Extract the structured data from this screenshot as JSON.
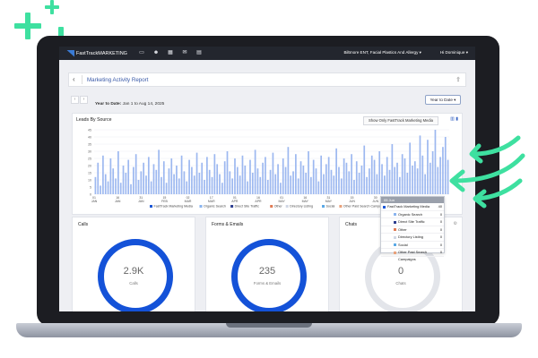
{
  "decor": {
    "accent": "#3ee0a0"
  },
  "nav": {
    "logo_text": "FastTrackMARKETING",
    "icons": [
      "monitor-icon",
      "users-icon",
      "calendar-icon",
      "mail-icon",
      "grid-icon"
    ],
    "organization": "Biltmore ENT, Facial Plastics And Allergy ▾",
    "user": "Hi Dominique ▾"
  },
  "header": {
    "title": "Marketing Activity Report",
    "back_icon": "chevron-left-icon",
    "share_icon": "share-icon"
  },
  "date_bar": {
    "prefix": "Year to Date:",
    "range": "Jan 1 to Aug 14, 2025",
    "range_button": "Year to Date ▾"
  },
  "leads_card": {
    "title": "Leads By Source",
    "filter_button": "Show Only FastTrack Marketing Media"
  },
  "chart_data": {
    "type": "bar",
    "title": "Leads By Source",
    "ylim": [
      0,
      45
    ],
    "y_ticks": [
      "0",
      "5",
      "10",
      "15",
      "20",
      "25",
      "30",
      "35",
      "40",
      "45"
    ],
    "x_ticks": [
      "01 JAN",
      "16 JAN",
      "31 JAN",
      "15 FEB",
      "02 MAR",
      "17 MAR",
      "01 APR",
      "16 APR",
      "01 MAY",
      "16 MAY",
      "31 MAY",
      "15 JUN",
      "30 JUN",
      "15 JUL",
      "30 JUL"
    ],
    "series": [
      {
        "name": "FastTrack Marketing Media",
        "color": "#1c57d6",
        "values": [
          12,
          22,
          6,
          27,
          14,
          9,
          25,
          18,
          11,
          30,
          8,
          20,
          15,
          24,
          7,
          19,
          28,
          10,
          16,
          22,
          13,
          26,
          9,
          21,
          17,
          31,
          12,
          23,
          8,
          18,
          25,
          14,
          20,
          11,
          27,
          16,
          9,
          24,
          19,
          13,
          29,
          15,
          22,
          10,
          26,
          17,
          12,
          28,
          21,
          14,
          8,
          23,
          30,
          16,
          11,
          25,
          19,
          13,
          27,
          20,
          9,
          24,
          15,
          31,
          18,
          12,
          22,
          26,
          10,
          17,
          29,
          14,
          21,
          8,
          25,
          19,
          33,
          13,
          16,
          28,
          11,
          23,
          20,
          15,
          30,
          12,
          24,
          18,
          9,
          27,
          14,
          21,
          26,
          17,
          13,
          32,
          19,
          11,
          25,
          22,
          16,
          28,
          10,
          23,
          15,
          20,
          34,
          12,
          18,
          27,
          24,
          14,
          30,
          21,
          13,
          26,
          17,
          35,
          19,
          22,
          12,
          28,
          25,
          15,
          36,
          20,
          23,
          18,
          41,
          27,
          14,
          38,
          22,
          30,
          45,
          19,
          26,
          33,
          40,
          24
        ]
      },
      {
        "name": "Organic Search",
        "color": "#8ab4ef",
        "values": []
      },
      {
        "name": "Direct Site Traffic",
        "color": "#2c3e8f",
        "values": []
      },
      {
        "name": "Other",
        "color": "#e07b54",
        "values": []
      },
      {
        "name": "Directory Listing",
        "color": "#cfd6e4",
        "values": []
      },
      {
        "name": "Social",
        "color": "#5aa9e6",
        "values": []
      },
      {
        "name": "Other Paid Search Campaigns",
        "color": "#e8a17a",
        "values": []
      }
    ],
    "legend": [
      "FastTrack Marketing Media",
      "Organic Search",
      "Direct Site Traffic",
      "Other",
      "Directory Listing",
      "Social",
      "Other Paid Search Campaigns"
    ],
    "legend_position": "bottom",
    "grid": true
  },
  "tooltip": {
    "header": "05 Jun",
    "rows": [
      {
        "label": "FastTrack Marketing Media",
        "value": "40",
        "color": "#1c57d6"
      },
      {
        "label": "Organic Search",
        "value": "0",
        "color": "#8ab4ef"
      },
      {
        "label": "Direct Site Traffic",
        "value": "0",
        "color": "#2c3e8f"
      },
      {
        "label": "Other",
        "value": "0",
        "color": "#e07b54"
      },
      {
        "label": "Directory Listing",
        "value": "0",
        "color": "#cfd6e4"
      },
      {
        "label": "Social",
        "value": "0",
        "color": "#5aa9e6"
      },
      {
        "label": "Other Paid Search Campaigns",
        "value": "0",
        "color": "#e8a17a"
      }
    ]
  },
  "cards": [
    {
      "title": "Calls",
      "value": "2.9K",
      "label": "Calls",
      "filled": true
    },
    {
      "title": "Forms & Emails",
      "value": "235",
      "label": "Forms & Emails",
      "filled": true
    },
    {
      "title": "Chats",
      "value": "0",
      "label": "Chats",
      "filled": false,
      "icon": "settings-icon"
    }
  ]
}
